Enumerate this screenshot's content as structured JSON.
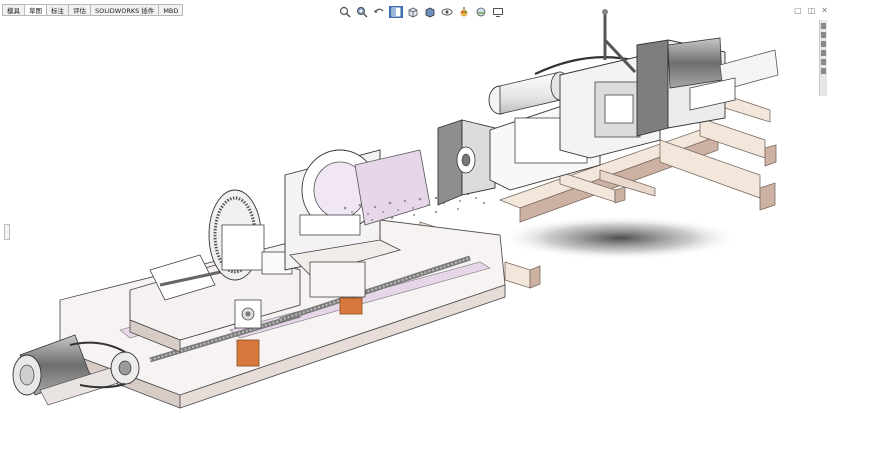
{
  "command_tabs": [
    {
      "label": "模具",
      "active": false
    },
    {
      "label": "草图",
      "active": true
    },
    {
      "label": "标注",
      "active": false
    },
    {
      "label": "评估",
      "active": false
    },
    {
      "label": "SOLIDWORKS 插件",
      "active": false
    },
    {
      "label": "MBD",
      "active": false
    }
  ],
  "view_toolbar_icons": [
    "zoom-to-fit-icon",
    "zoom-area-icon",
    "previous-view-icon",
    "section-view-icon",
    "view-orientation-icon",
    "display-style-icon",
    "hide-show-items-icon",
    "edit-appearance-icon",
    "apply-scene-icon",
    "view-settings-icon"
  ],
  "window_controls": [
    "restore-icon",
    "tile-icon",
    "close-icon"
  ],
  "colors": {
    "accent": "#3c6fb0",
    "frame": "#f6f3f2",
    "frame_shade": "#d7ccc6",
    "beam": "#f3e6da",
    "beam_shade": "#cdb2a4",
    "lilac": "#e7d6ea",
    "orange": "#d9783c",
    "motor": "#8a8a8a"
  }
}
